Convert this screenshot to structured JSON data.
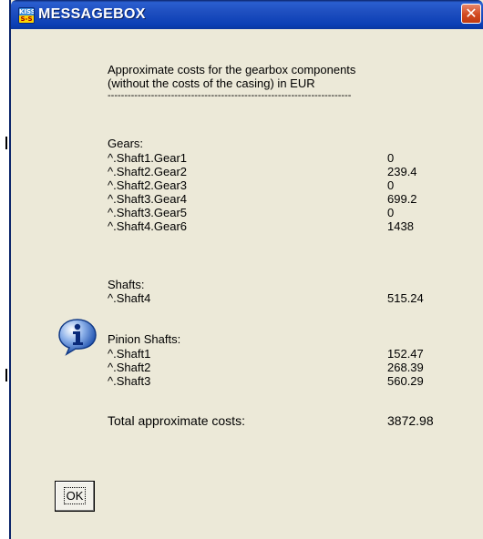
{
  "window": {
    "title": "MESSAGEBOX",
    "app_icon_text_top": "KISS",
    "app_icon_text_bottom": "S-S",
    "close_glyph": "✕"
  },
  "message": {
    "heading_line1": "Approximate costs for the gearbox components",
    "heading_line2": "(without the costs of the casing) in EUR",
    "separator": "-------------------------------------------------------------------------",
    "gears": {
      "label": "Gears:",
      "items": [
        {
          "name": "^.Shaft1.Gear1",
          "value": "0"
        },
        {
          "name": "^.Shaft2.Gear2",
          "value": "239.4"
        },
        {
          "name": "^.Shaft2.Gear3",
          "value": "0"
        },
        {
          "name": "^.Shaft3.Gear4",
          "value": "699.2"
        },
        {
          "name": "^.Shaft3.Gear5",
          "value": "0"
        },
        {
          "name": "^.Shaft4.Gear6",
          "value": "1438"
        }
      ]
    },
    "shafts": {
      "label": "Shafts:",
      "items": [
        {
          "name": "^.Shaft4",
          "value": "515.24"
        }
      ]
    },
    "pinion_shafts": {
      "label": "Pinion Shafts:",
      "items": [
        {
          "name": "^.Shaft1",
          "value": "152.47"
        },
        {
          "name": "^.Shaft2",
          "value": "268.39"
        },
        {
          "name": "^.Shaft3",
          "value": "560.29"
        }
      ]
    },
    "total": {
      "label": "Total approximate costs:",
      "value": "3872.98"
    }
  },
  "buttons": {
    "ok_label": "OK"
  },
  "icons": {
    "dialog": "info-icon"
  },
  "colors": {
    "titlebar": "#0b3fb5",
    "dialog_bg": "#ece9d8",
    "close": "#d24a20"
  }
}
